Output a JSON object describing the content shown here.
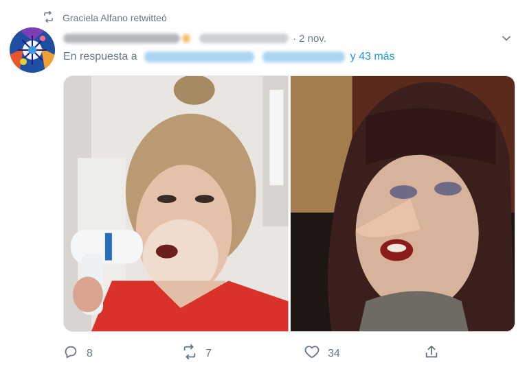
{
  "retweet": {
    "icon": "retweet-icon",
    "text": "Graciela Alfano retwitteó"
  },
  "tweet": {
    "date": "· 2 nov.",
    "reply_prefix": "En respuesta a",
    "reply_more": "y 43 más"
  },
  "actions": {
    "replies": "8",
    "retweets": "7",
    "likes": "34"
  },
  "colors": {
    "link": "#1b95e0",
    "muted": "#657786"
  }
}
